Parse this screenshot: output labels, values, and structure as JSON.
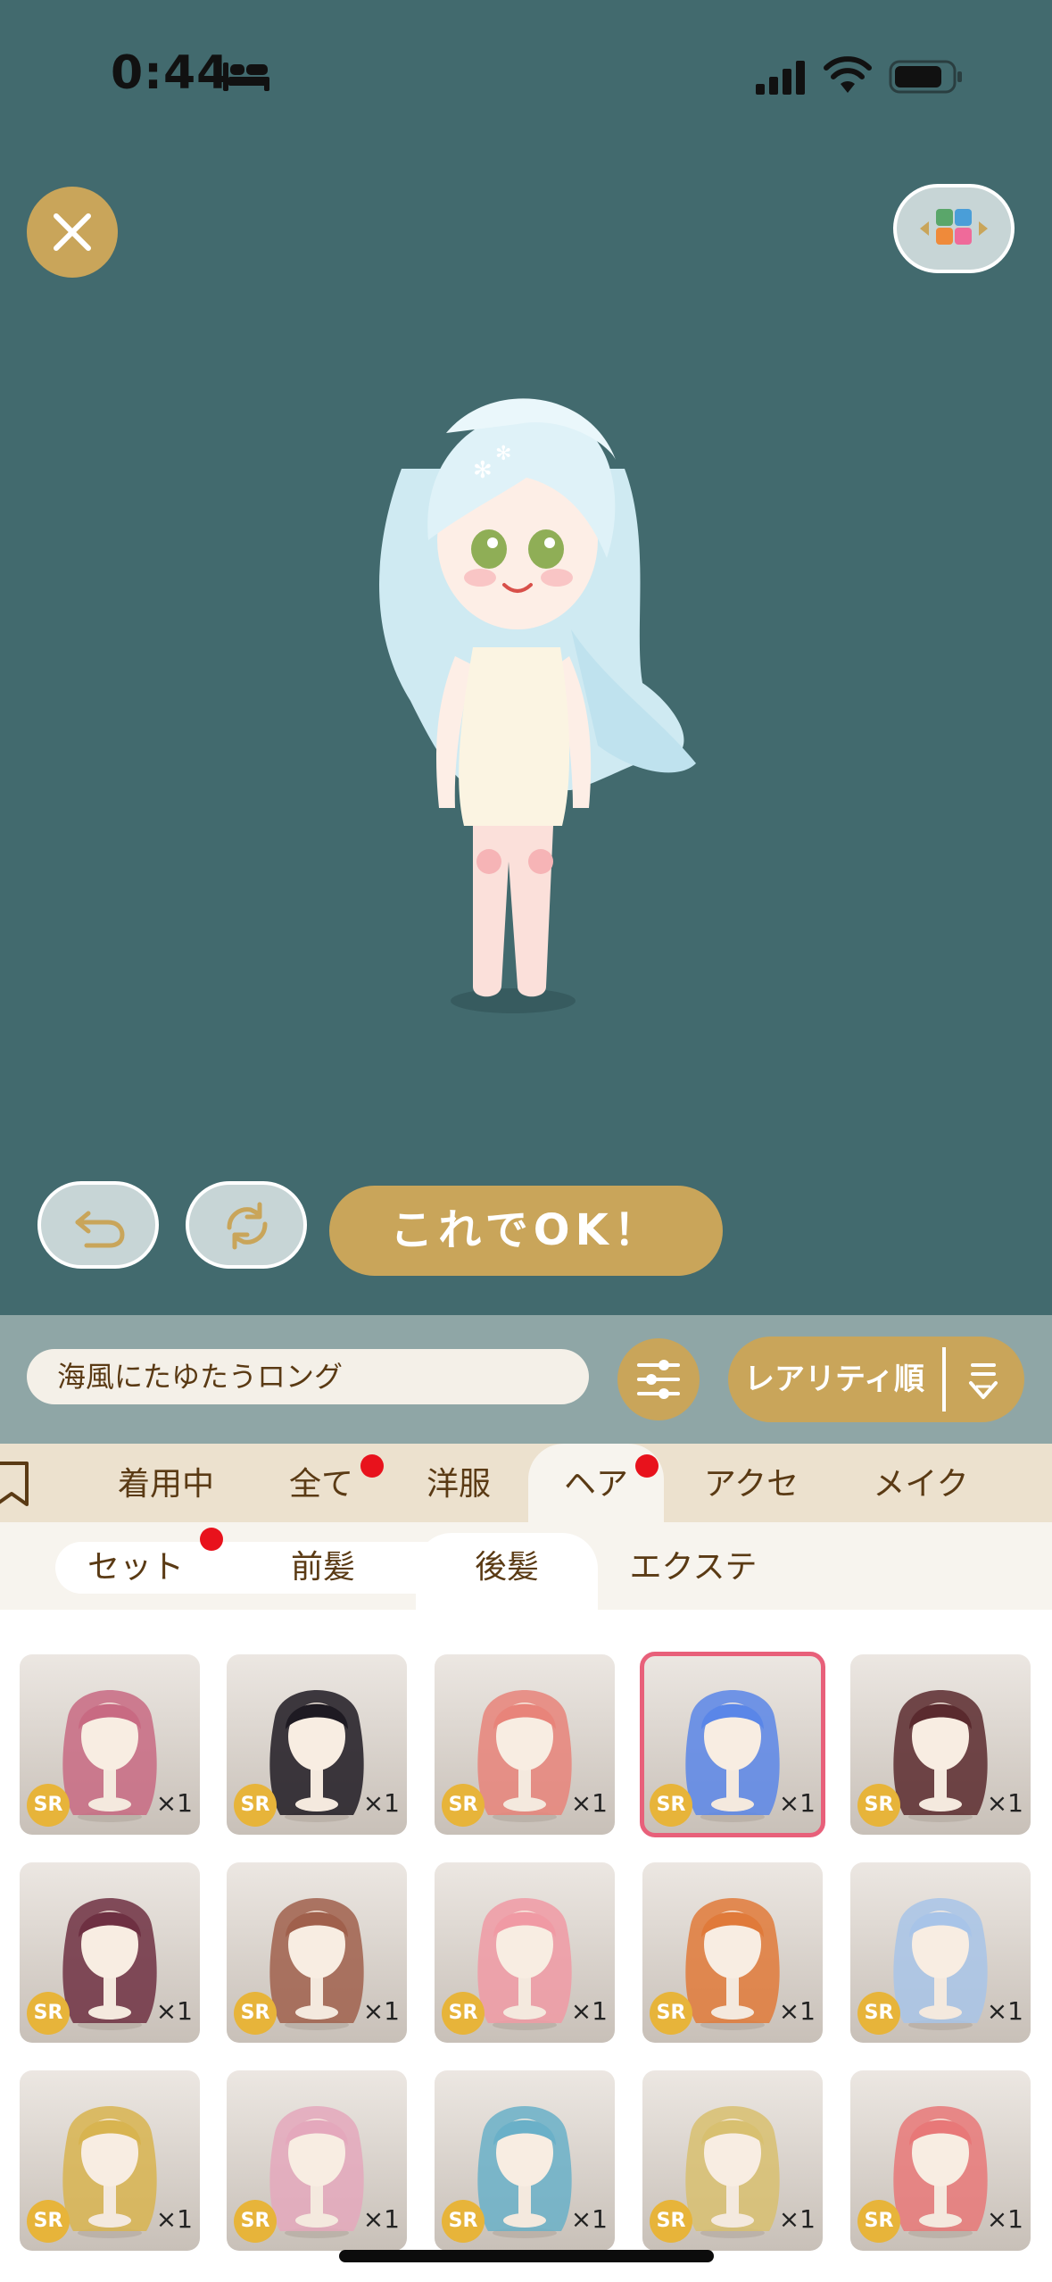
{
  "status_bar": {
    "time": "0:44"
  },
  "editor": {
    "ok_label": "これでOK！"
  },
  "search": {
    "value": "海風にたゆたうロング"
  },
  "sort": {
    "label": "レアリティ順"
  },
  "category_tabs": [
    {
      "label": "着用中",
      "active": false,
      "dot": false
    },
    {
      "label": "全て",
      "active": false,
      "dot": true
    },
    {
      "label": "洋服",
      "active": false,
      "dot": false
    },
    {
      "label": "ヘア",
      "active": true,
      "dot": true
    },
    {
      "label": "アクセ",
      "active": false,
      "dot": false
    },
    {
      "label": "メイク",
      "active": false,
      "dot": false
    }
  ],
  "sub_tabs": [
    {
      "label": "セット",
      "active": false,
      "dot": true
    },
    {
      "label": "前髪",
      "active": false,
      "dot": false
    },
    {
      "label": "後髪",
      "active": true,
      "dot": false
    },
    {
      "label": "エクステ",
      "active": false,
      "dot": false
    }
  ],
  "items": [
    {
      "rarity": "SR",
      "count": "×1",
      "color": "#c86a82",
      "selected": false
    },
    {
      "rarity": "SR",
      "count": "×1",
      "color": "#1e1a22",
      "selected": false
    },
    {
      "rarity": "SR",
      "count": "×1",
      "color": "#e8847a",
      "selected": false
    },
    {
      "rarity": "SR",
      "count": "×1",
      "color": "#5a86e8",
      "selected": true
    },
    {
      "rarity": "SR",
      "count": "×1",
      "color": "#5a2a2e",
      "selected": false
    },
    {
      "rarity": "SR",
      "count": "×1",
      "color": "#6e3042",
      "selected": false
    },
    {
      "rarity": "SR",
      "count": "×1",
      "color": "#a0604c",
      "selected": false
    },
    {
      "rarity": "SR",
      "count": "×1",
      "color": "#f09aa4",
      "selected": false
    },
    {
      "rarity": "SR",
      "count": "×1",
      "color": "#e07a3a",
      "selected": false
    },
    {
      "rarity": "SR",
      "count": "×1",
      "color": "#a8c4e8",
      "selected": false
    },
    {
      "rarity": "SR",
      "count": "×1",
      "color": "#d8b450",
      "selected": false
    },
    {
      "rarity": "SR",
      "count": "×1",
      "color": "#e4a8bc",
      "selected": false
    },
    {
      "rarity": "SR",
      "count": "×1",
      "color": "#6ab0c8",
      "selected": false
    },
    {
      "rarity": "SR",
      "count": "×1",
      "color": "#d8c070",
      "selected": false
    },
    {
      "rarity": "SR",
      "count": "×1",
      "color": "#e87878",
      "selected": false
    }
  ],
  "colors": {
    "stage_bg": "#426a6e",
    "accent_gold": "#c9a55a",
    "tab_bg": "#ece1ce",
    "badge_red": "#e8121c",
    "rarity_badge": "#e7b43a",
    "selected_outline": "#e8607a"
  }
}
